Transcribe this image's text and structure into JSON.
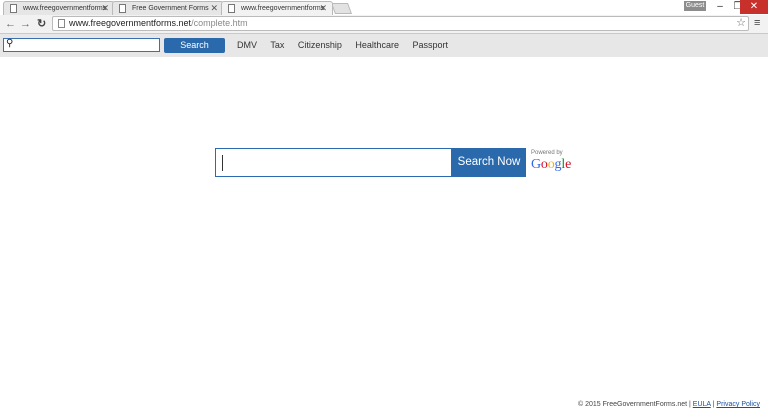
{
  "browser": {
    "tabs": [
      {
        "title": "www.freegovernmentforms",
        "active": false
      },
      {
        "title": "Free Government Forms",
        "active": false
      },
      {
        "title": "www.freegovernmentforms",
        "active": true
      }
    ],
    "profile_label": "Guest",
    "address_host": "www.freegovernmentforms.net",
    "address_path": "/complete.htm"
  },
  "sitebar": {
    "search_button": "Search",
    "links": [
      "DMV",
      "Tax",
      "Citizenship",
      "Healthcare",
      "Passport"
    ]
  },
  "main_search": {
    "button_label": "Search Now",
    "powered_by": "Powered by",
    "provider": "Google"
  },
  "footer": {
    "copyright": "© 2015 FreeGovernmentForms.net |",
    "eula": "EULA",
    "separator": "|",
    "privacy": "Privacy Policy"
  },
  "colors": {
    "accent": "#2b69ad",
    "close_button": "#c7302b"
  }
}
